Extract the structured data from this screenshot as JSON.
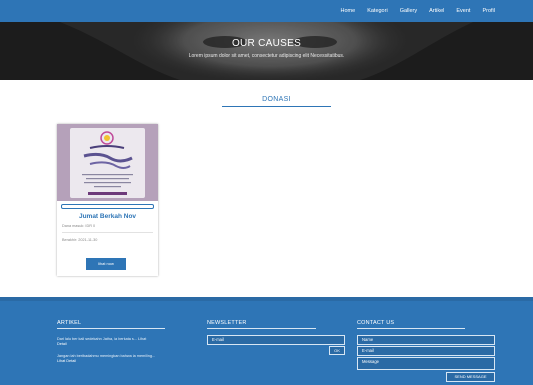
{
  "nav": {
    "items": [
      "Home",
      "Kategori",
      "Gallery",
      "Artikel",
      "Event",
      "Profil"
    ]
  },
  "hero": {
    "title": "OUR CAUSES",
    "subtitle": "Lorem ipsum dolor sit amet, consectetur adipiscing elit Necessitatibus."
  },
  "section": {
    "title": "DONASI"
  },
  "card": {
    "title": "Jumat Berkah Nov",
    "meta": "Dana masuk: IDR 0",
    "date": "Berakhir: 2021-11-30",
    "button": "lihat now",
    "progress": 0
  },
  "footer": {
    "artikel": {
      "title": "ARTIKEL",
      "items": [
        {
          "text": "Dari lalu ber kali sedekahn Jatha, ia berkata s... Lihat",
          "more": "Detail"
        },
        {
          "text": "Jangan lah beribadahmu memingkan bahwa ia memiling...",
          "more": "Lihat Detail"
        }
      ]
    },
    "newsletter": {
      "title": "NEWSLETTER",
      "email_placeholder": "E-mail",
      "ok": "OK"
    },
    "contact": {
      "title": "CONTACT US",
      "name_placeholder": "Name",
      "email_placeholder": "E-mail",
      "message_placeholder": "Message",
      "send": "SEND MESSAGE"
    }
  }
}
